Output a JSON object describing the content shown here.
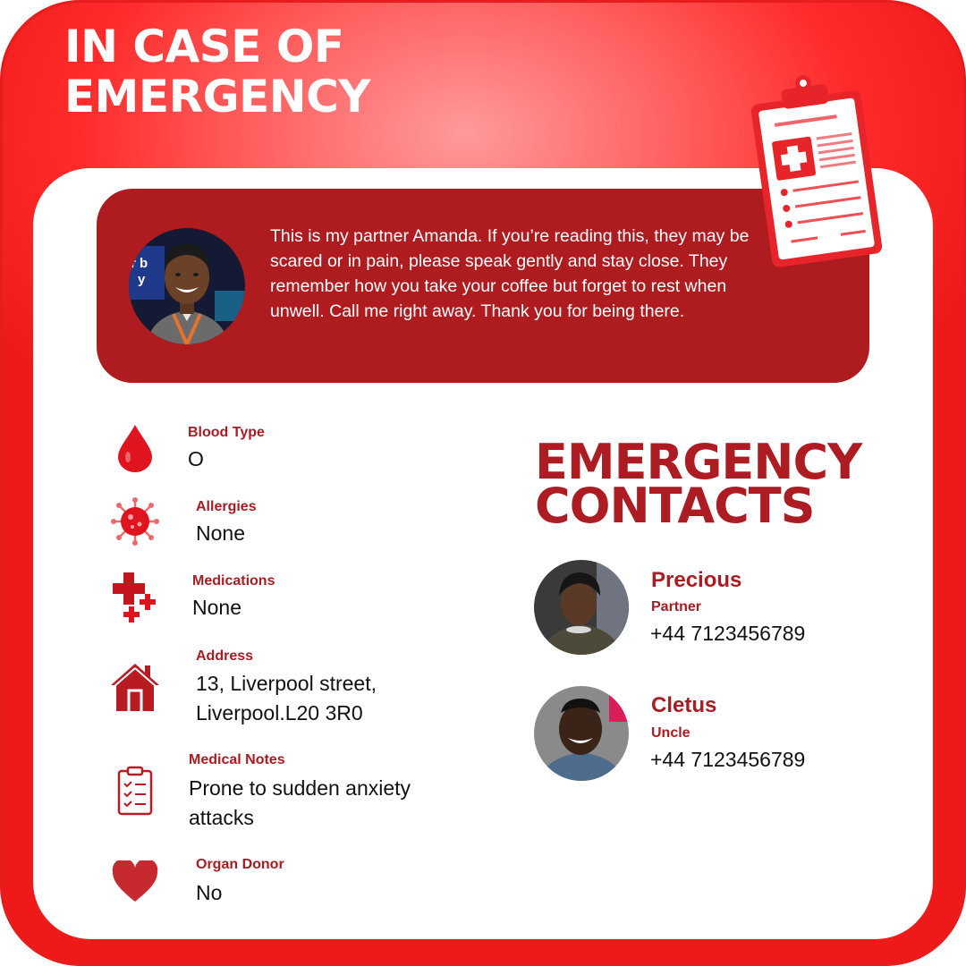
{
  "header": {
    "title_line1": "IN CASE OF",
    "title_line2": "EMERGENCY"
  },
  "banner": {
    "message": "This is my partner Amanda. If you’re reading this, they may be scared or in pain, please speak gently and stay close. They remember how you take your coffee but forget to rest when unwell. Call me right away. Thank you for being there.",
    "photo_sign_text_1": "r b",
    "photo_sign_text_2": "y"
  },
  "info": [
    {
      "label": "Blood Type",
      "value": "O",
      "icon": "blood-drop-icon"
    },
    {
      "label": "Allergies",
      "value": "None",
      "icon": "germ-icon"
    },
    {
      "label": "Medications",
      "value": "None",
      "icon": "medical-cross-icon"
    },
    {
      "label": "Address",
      "value": "13, Liverpool street,\nLiverpool.L20 3R0",
      "icon": "house-icon"
    },
    {
      "label": "Medical Notes",
      "value": "Prone to sudden anxiety\nattacks",
      "icon": "checklist-icon"
    },
    {
      "label": "Organ Donor",
      "value": "No",
      "icon": "heart-icon"
    }
  ],
  "contacts_section": {
    "title_line1": "EMERGENCY",
    "title_line2": "CONTACTS"
  },
  "contacts": [
    {
      "name": "Precious",
      "relation": "Partner",
      "phone": "+44 7123456789"
    },
    {
      "name": "Cletus",
      "relation": "Uncle",
      "phone": "+44 7123456789"
    }
  ],
  "colors": {
    "brand_red": "#ed1c24",
    "dark_red": "#af1c20",
    "label_red": "#a81c22",
    "text_black": "#111111",
    "white": "#ffffff"
  }
}
